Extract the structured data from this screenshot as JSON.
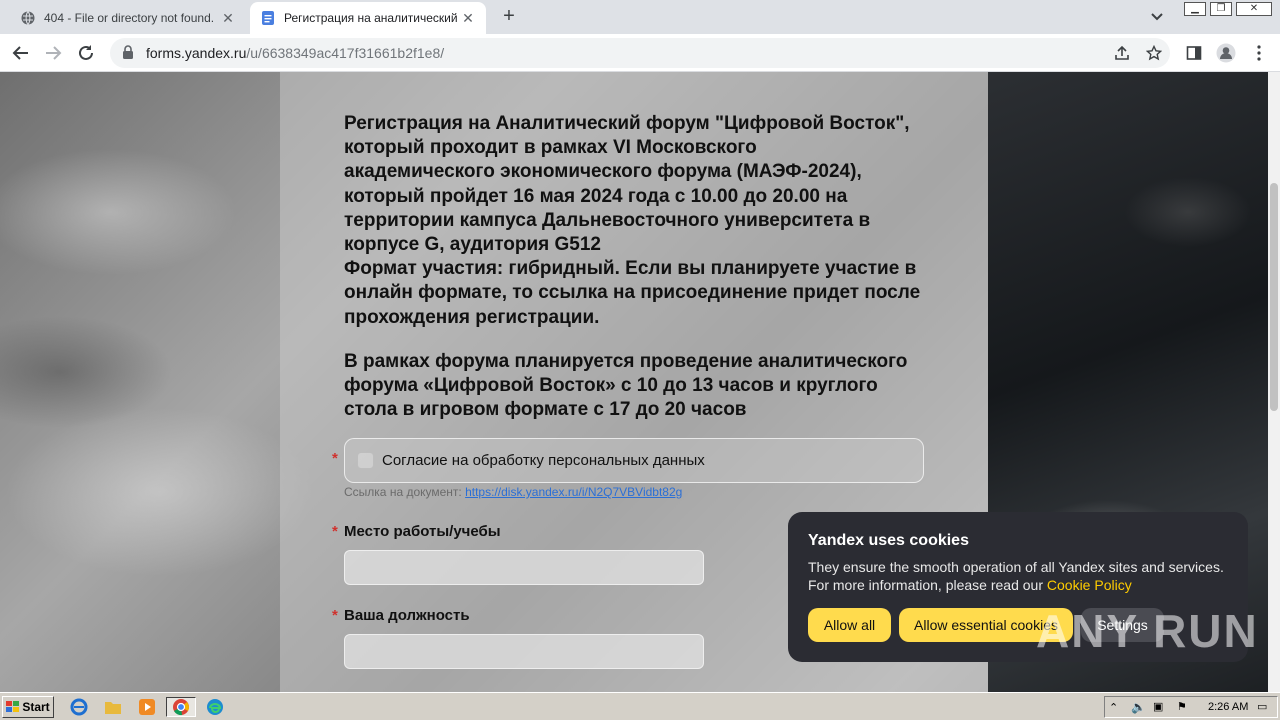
{
  "browser": {
    "tabs": [
      {
        "title": "404 - File or directory not found.",
        "active": false
      },
      {
        "title": "Регистрация на аналитический фо",
        "active": true
      }
    ],
    "url_host": "forms.yandex.ru",
    "url_path": "/u/6638349ac417f31661b2f1e8/"
  },
  "form": {
    "intro_paragraph_1": "Регистрация на Аналитический форум \"Цифровой Восток\",\nкоторый проходит в рамках VI Московского\nакадемического экономического форума (МАЭФ-2024),\nкоторый пройдет 16 мая 2024 года с 10.00 до 20.00 на\nтерритории кампуса Дальневосточного университета в\nкорпусе G, аудитория G512\nФормат участия: гибридный. Если вы планируете участие в\nонлайн формате, то ссылка на присоединение придет после\nпрохождения регистрации.",
    "intro_paragraph_2": "В рамках форума планируется проведение аналитического\nфорума «Цифровой Восток» с 10 до 13 часов и круглого\nстола в игровом формате с 17 до 20 часов",
    "required_mark": "*",
    "consent_label": "Согласие на обработку персональных данных",
    "doc_link_prefix": "Ссылка на документ: ",
    "doc_link_url": "https://disk.yandex.ru/i/N2Q7VBVidbt82g",
    "field_workplace_label": "Место работы/учебы",
    "field_position_label": "Ваша должность"
  },
  "cookie_banner": {
    "title": "Yandex uses cookies",
    "text": "They ensure the smooth operation of all Yandex sites and services. For more information, please read our ",
    "link": "Cookie Policy",
    "allow_all": "Allow all",
    "allow_essential": "Allow essential cookies",
    "settings": "Settings"
  },
  "watermark": "ANY RUN",
  "taskbar": {
    "start_label": "Start",
    "clock": "2:26 AM"
  },
  "colors": {
    "accent_yellow": "#ffdb4d",
    "required_red": "#d0312d",
    "link_blue": "#2b6fd6",
    "cookie_bg": "#2b2c33"
  }
}
